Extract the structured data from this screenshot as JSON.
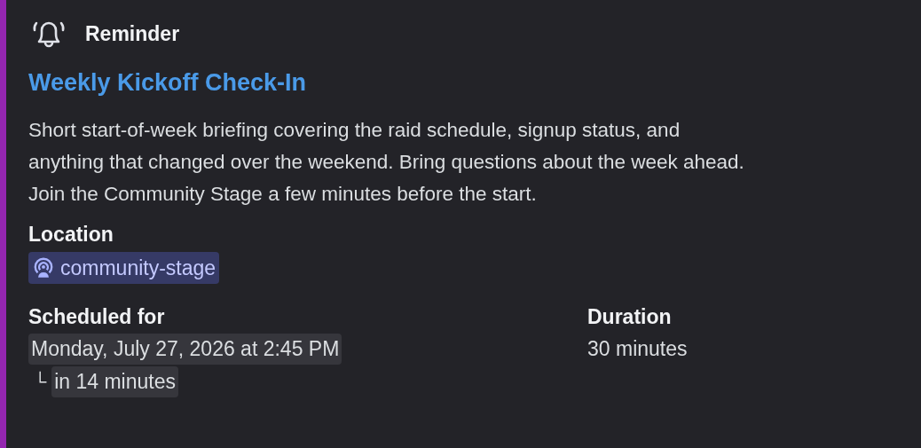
{
  "header": {
    "label": "Reminder"
  },
  "event": {
    "title": "Weekly Kickoff Check-In",
    "description": "Short start-of-week briefing covering the raid schedule, signup status, and\nanything that changed over the weekend. Bring questions about the week ahead.\nJoin the Community Stage a few minutes before the start."
  },
  "location": {
    "label": "Location",
    "channel": "community-stage"
  },
  "fields": [
    {
      "label": "Scheduled for",
      "value": "Monday, July 27, 2026 at 2:45 PM",
      "branch": "└",
      "relative": "in 14 minutes"
    },
    {
      "label": "Duration",
      "value": "30 minutes"
    }
  ]
}
